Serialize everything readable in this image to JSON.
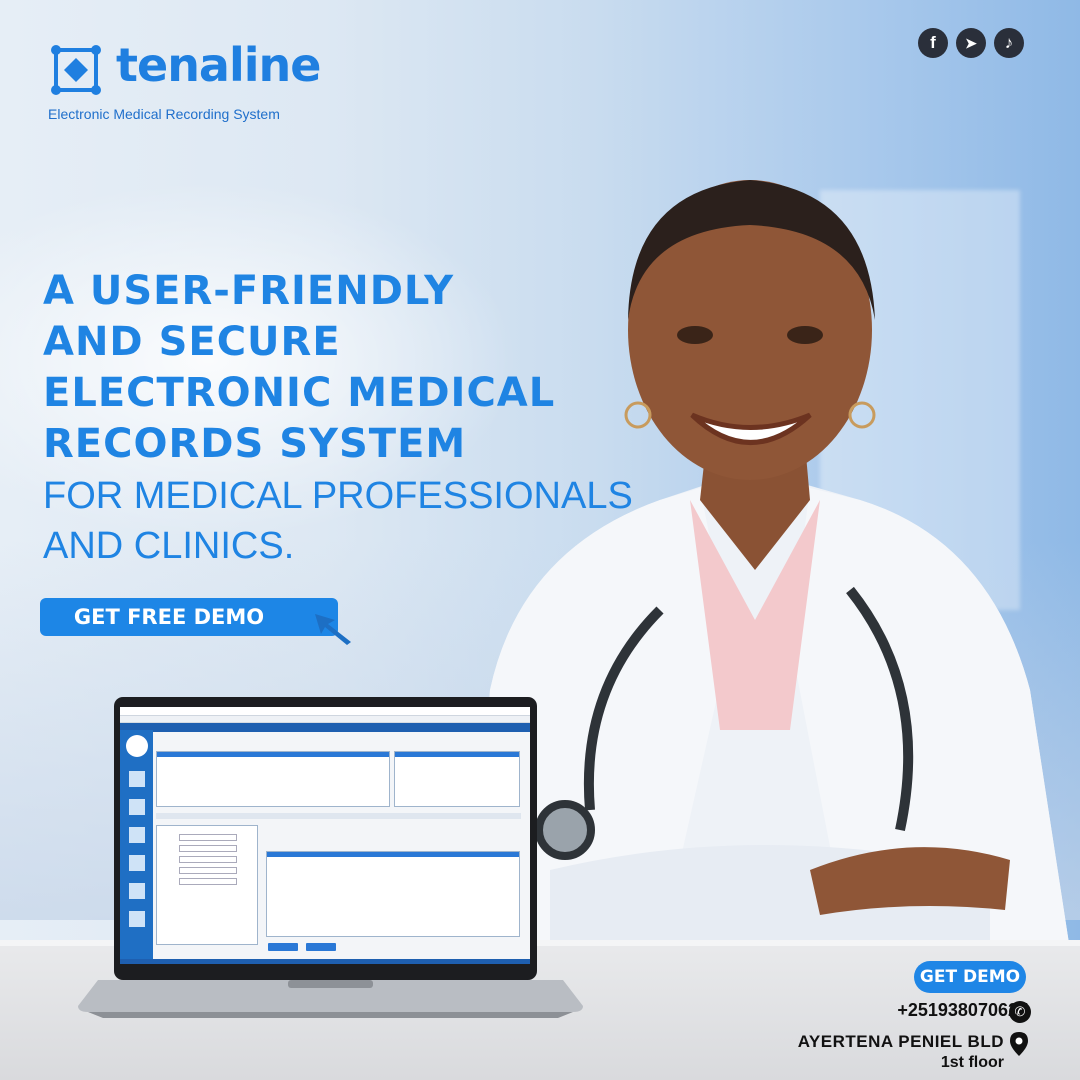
{
  "brand": {
    "name": "tenaline",
    "tagline": "Electronic Medical Recording System"
  },
  "social": [
    {
      "icon": "facebook-icon",
      "glyph": "f"
    },
    {
      "icon": "telegram-icon",
      "glyph": "➤"
    },
    {
      "icon": "tiktok-icon",
      "glyph": "♪"
    }
  ],
  "headline": {
    "bold_lines": [
      "A USER-FRIENDLY",
      "AND SECURE",
      "ELECTRONIC MEDICAL",
      "RECORDS SYSTEM"
    ],
    "sub_lines": [
      "FOR MEDICAL PROFESSIONALS",
      "AND CLINICS."
    ]
  },
  "cta": {
    "label": "GET FREE DEMO"
  },
  "contact": {
    "button_label": "GET DEMO",
    "phone": "+251938070627",
    "address_line1": "AYERTENA PENIEL BLD",
    "address_line2": "1st floor"
  },
  "colors": {
    "accent": "#1f84e3",
    "dark": "#111111"
  }
}
